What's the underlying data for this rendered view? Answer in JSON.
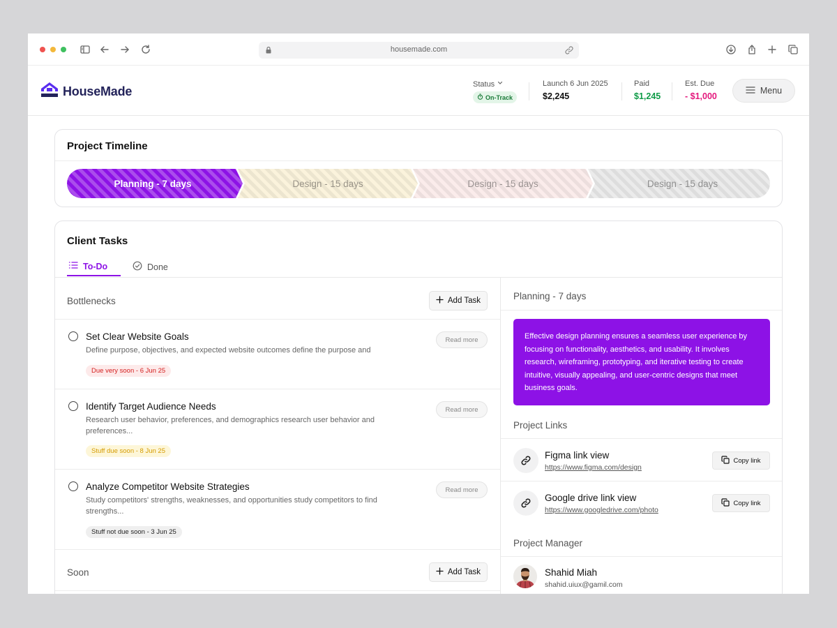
{
  "browser": {
    "url": "housemade.com",
    "dots": [
      "#ef5350",
      "#f3b83b",
      "#3fc05f"
    ]
  },
  "brand": {
    "name": "HouseMade",
    "color": "#23235a",
    "accent": "#8d12e6"
  },
  "header": {
    "status": {
      "label": "Status",
      "badge": "On-Track"
    },
    "launch": {
      "label": "Launch 6 Jun 2025",
      "value": "$2,245"
    },
    "paid": {
      "label": "Paid",
      "value": "$1,245",
      "color": "#0f9b47"
    },
    "due": {
      "label": "Est. Due",
      "value": "- $1,000",
      "color": "#e4197d"
    },
    "menu_label": "Menu"
  },
  "timeline": {
    "title": "Project Timeline",
    "phases": [
      {
        "label": "Planning - 7 days",
        "fill": "#8d12e6",
        "text": "#ffffff",
        "active": true
      },
      {
        "label": "Design - 15 days",
        "fill": "#fbf3dc",
        "text": "#9a9488",
        "active": false
      },
      {
        "label": "Design - 15 days",
        "fill": "#fbeceb",
        "text": "#9a9291",
        "active": false
      },
      {
        "label": "Design - 15 days",
        "fill": "#ebebeb",
        "text": "#8f8f8f",
        "active": false
      }
    ]
  },
  "tasks": {
    "title": "Client Tasks",
    "tabs": {
      "todo": "To-Do",
      "done": "Done"
    },
    "bottlenecks": {
      "label": "Bottlenecks",
      "add_label": "Add Task",
      "items": [
        {
          "title": "Set Clear Website Goals",
          "desc": "Define purpose, objectives, and expected website outcomes define the purpose and",
          "read_more": "Read more",
          "due": "Due very soon - 6 Jun 25"
        },
        {
          "title": "Identify Target Audience Needs",
          "desc": "Research user behavior, preferences, and demographics research user behavior and preferences...",
          "read_more": "Read more",
          "due": "Stuff due soon - 8 Jun 25"
        },
        {
          "title": "Analyze Competitor Website Strategies",
          "desc": "Study competitors' strengths, weaknesses, and opportunities study competitors to find strengths...",
          "read_more": "Read more",
          "due": "Stuff not due soon - 3 Jun 25"
        }
      ]
    },
    "soon": {
      "label": "Soon",
      "add_label": "Add Task"
    }
  },
  "details": {
    "phase_title": "Planning - 7 days",
    "description": "Effective design planning ensures a seamless user experience by focusing on functionality, aesthetics, and usability. It involves research, wireframing, prototyping, and iterative testing to create intuitive, visually appealing, and user-centric designs that meet business goals.",
    "links_label": "Project Links",
    "links": [
      {
        "title": "Figma link view",
        "url": "https://www.figma.com/design",
        "copy": "Copy link"
      },
      {
        "title": "Google drive link view",
        "url": "https://www.googledrive.com/photo",
        "copy": "Copy link"
      }
    ],
    "manager_label": "Project Manager",
    "manager": {
      "name": "Shahid Miah",
      "email": "shahid.uiux@gamil.com"
    }
  }
}
